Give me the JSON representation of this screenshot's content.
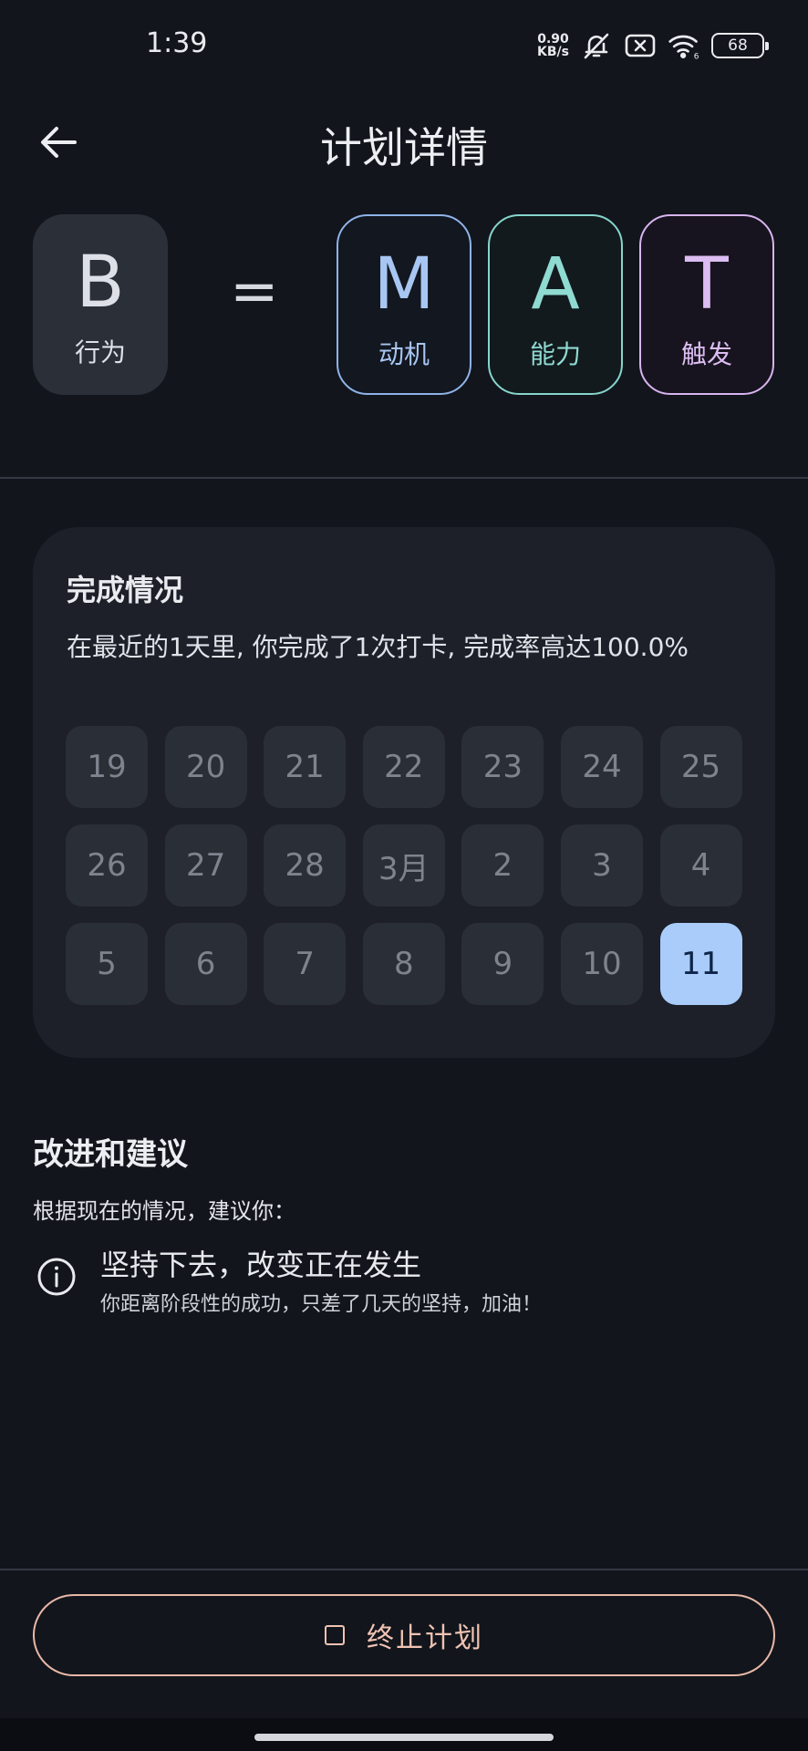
{
  "status_bar": {
    "time": "1:39",
    "net_speed_value": "0.90",
    "net_speed_unit": "KB/s",
    "battery": "68",
    "icons": [
      "mute-bell-icon",
      "sim-x-icon",
      "wifi-6-icon",
      "battery-icon"
    ]
  },
  "header": {
    "title": "计划详情",
    "back_icon": "arrow-left-icon"
  },
  "formula": {
    "behavior": {
      "letter": "B",
      "label": "行为"
    },
    "equals": "=",
    "motivation": {
      "letter": "M",
      "label": "动机",
      "color": "#a8c6f2"
    },
    "ability": {
      "letter": "A",
      "label": "能力",
      "color": "#8fdad1"
    },
    "trigger": {
      "letter": "T",
      "label": "触发",
      "color": "#dcbdf2"
    }
  },
  "completion": {
    "title": "完成情况",
    "description": "在最近的1天里, 你完成了1次打卡, 完成率高达100.0%",
    "days": [
      "19",
      "20",
      "21",
      "22",
      "23",
      "24",
      "25",
      "26",
      "27",
      "28",
      "3月",
      "2",
      "3",
      "4",
      "5",
      "6",
      "7",
      "8",
      "9",
      "10",
      "11"
    ],
    "checked_day": "11",
    "checked_color": "#a9ccfb"
  },
  "suggestions": {
    "title": "改进和建议",
    "intro": "根据现在的情况，建议你：",
    "items": [
      {
        "icon": "info-circle-icon",
        "title": "坚持下去，改变正在发生",
        "detail": "你距离阶段性的成功，只差了几天的坚持，加油！"
      }
    ]
  },
  "stop_button": {
    "icon": "stop-square-icon",
    "label": "终止计划",
    "color": "#f0c3b3"
  }
}
